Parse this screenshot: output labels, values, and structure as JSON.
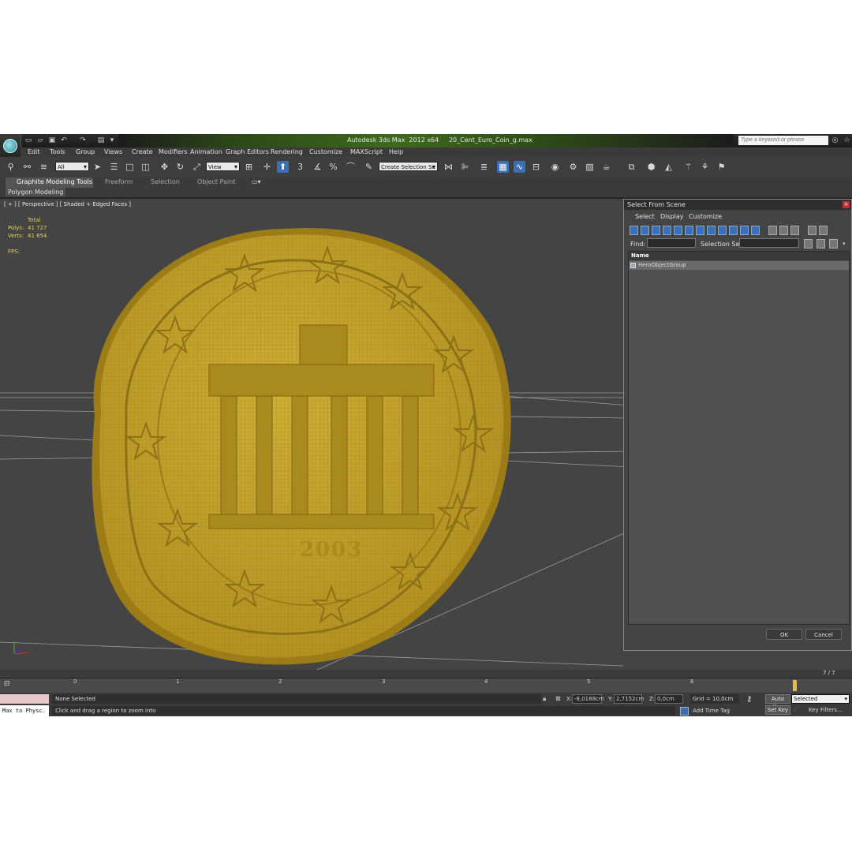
{
  "window": {
    "title": "Autodesk 3ds Max  2012 x64     20_Cent_Euro_Coin_g.max",
    "search_placeholder": "Type a keyword or phrase"
  },
  "menu": [
    "Edit",
    "Tools",
    "Group",
    "Views",
    "Create",
    "Modifiers",
    "Animation",
    "Graph Editors",
    "Rendering",
    "Customize",
    "MAXScript",
    "Help"
  ],
  "toolbar": {
    "selection_filter": "All",
    "reference_coord": "View",
    "named_selection_placeholder": "Create Selection Se",
    "snap_label": "3",
    "angle_snap_label": "%"
  },
  "ribbon": {
    "tabs": [
      "Graphite Modeling Tools",
      "Freeform",
      "Selection",
      "Object Paint"
    ],
    "active_panel": "Polygon Modeling"
  },
  "viewport": {
    "label": "[ + ] [ Perspective ] [ Shaded + Edged Faces ]",
    "stats": {
      "total_label": "Total",
      "polys_label": "Polys:",
      "polys_value": "41 727",
      "verts_label": "Verts:",
      "verts_value": "41 654",
      "fps_label": "FPS:"
    },
    "coin_year": "2003",
    "coin_color": "#c5a22c"
  },
  "dialog": {
    "title": "Select From Scene",
    "menu": [
      "Select",
      "Display",
      "Customize"
    ],
    "find_label": "Find:",
    "selection_set_label": "Selection Set:",
    "column_name": "Name",
    "items": [
      "HeroObjectGroup"
    ],
    "ok": "OK",
    "cancel": "Cancel"
  },
  "timeline": {
    "frame_counter": "7 / 7",
    "ticks": [
      "0",
      "1",
      "2",
      "3",
      "4",
      "5",
      "6"
    ]
  },
  "status": {
    "maxscript": "Max to Physc.",
    "selection": "None Selected",
    "prompt": "Click and drag a region to zoom into",
    "x_label": "X:",
    "x_value": "-8,0188cm",
    "y_label": "Y:",
    "y_value": "2,7152cm",
    "z_label": "Z:",
    "z_value": "0,0cm",
    "grid": "Grid = 10,0cm",
    "add_time_tag": "Add Time Tag",
    "auto_key": "Auto Key",
    "set_key": "Set Key",
    "selected": "Selected",
    "key_filters": "Key Filters..."
  }
}
